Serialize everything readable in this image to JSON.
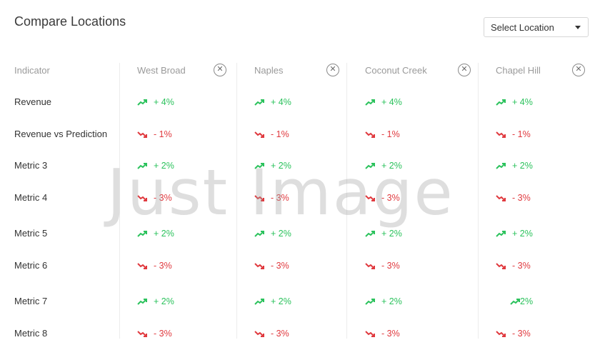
{
  "header": {
    "title": "Compare Locations",
    "select_label": "Select Location"
  },
  "table": {
    "indicator_header": "Indicator",
    "columns": [
      {
        "name": "West Broad"
      },
      {
        "name": "Naples"
      },
      {
        "name": "Coconut Creek"
      },
      {
        "name": "Chapel Hill"
      }
    ],
    "rows": [
      {
        "label": "Revenue",
        "cells": [
          {
            "text": "+ 4%",
            "trend": "up"
          },
          {
            "text": "+ 4%",
            "trend": "up"
          },
          {
            "text": "+ 4%",
            "trend": "up"
          },
          {
            "text": "+ 4%",
            "trend": "up"
          }
        ]
      },
      {
        "label": "Revenue vs Prediction",
        "cells": [
          {
            "text": "- 1%",
            "trend": "down"
          },
          {
            "text": "- 1%",
            "trend": "down"
          },
          {
            "text": "- 1%",
            "trend": "down"
          },
          {
            "text": "- 1%",
            "trend": "down"
          }
        ]
      },
      {
        "label": "Metric 3",
        "cells": [
          {
            "text": "+ 2%",
            "trend": "up"
          },
          {
            "text": "+ 2%",
            "trend": "up"
          },
          {
            "text": "+ 2%",
            "trend": "up"
          },
          {
            "text": "+ 2%",
            "trend": "up"
          }
        ]
      },
      {
        "label": "Metric 4",
        "cells": [
          {
            "text": "- 3%",
            "trend": "down"
          },
          {
            "text": "- 3%",
            "trend": "down"
          },
          {
            "text": "- 3%",
            "trend": "down"
          },
          {
            "text": "- 3%",
            "trend": "down"
          }
        ]
      },
      {
        "label": "Metric 5",
        "cells": [
          {
            "text": "+ 2%",
            "trend": "up"
          },
          {
            "text": "+ 2%",
            "trend": "up"
          },
          {
            "text": "+ 2%",
            "trend": "up"
          },
          {
            "text": "+ 2%",
            "trend": "up"
          }
        ]
      },
      {
        "label": "Metric 6",
        "cells": [
          {
            "text": "- 3%",
            "trend": "down"
          },
          {
            "text": "- 3%",
            "trend": "down"
          },
          {
            "text": "- 3%",
            "trend": "down"
          },
          {
            "text": "- 3%",
            "trend": "down"
          }
        ]
      },
      {
        "label": "Metric 7",
        "cells": [
          {
            "text": "+ 2%",
            "trend": "up"
          },
          {
            "text": "+ 2%",
            "trend": "up"
          },
          {
            "text": "+ 2%",
            "trend": "up"
          },
          {
            "text": "2%",
            "trend": "up"
          }
        ]
      },
      {
        "label": "Metric 8",
        "cells": [
          {
            "text": "- 3%",
            "trend": "down"
          },
          {
            "text": "- 3%",
            "trend": "down"
          },
          {
            "text": "- 3%",
            "trend": "down"
          },
          {
            "text": "- 3%",
            "trend": "down"
          }
        ]
      }
    ]
  },
  "watermark": "Just Image",
  "colors": {
    "up": "#2bc25c",
    "down": "#e0393e"
  },
  "icons": {
    "up": "trending-up-icon",
    "down": "trending-down-icon",
    "remove": "close-circle-icon",
    "select": "caret-down-icon"
  }
}
